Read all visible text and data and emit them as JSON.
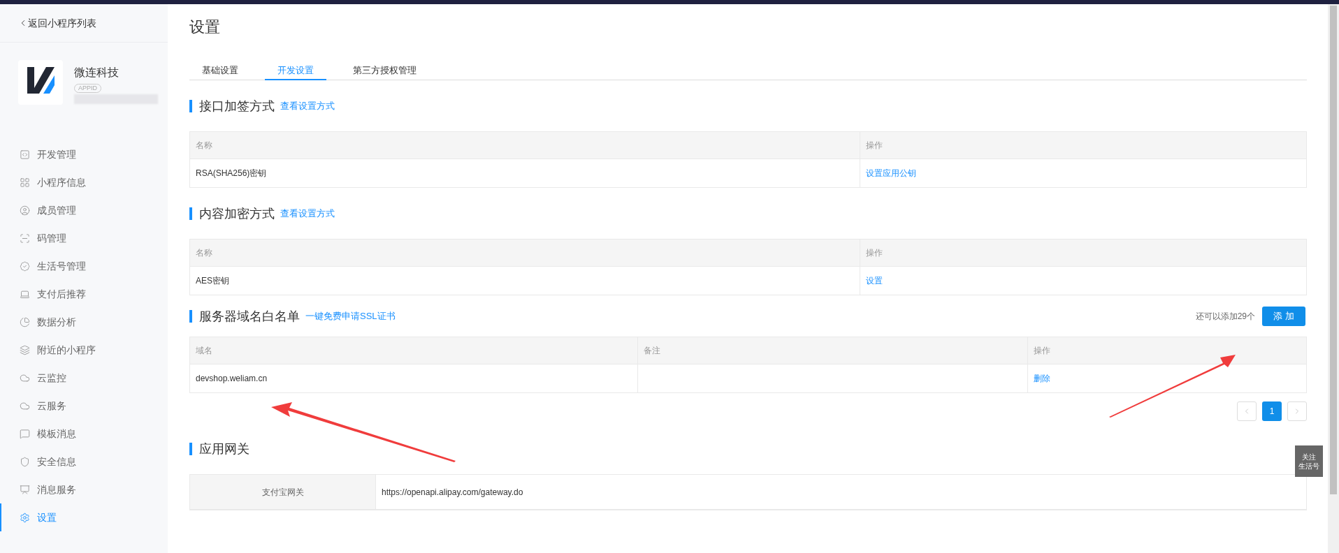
{
  "sidebar": {
    "back_link": "返回小程序列表",
    "app": {
      "name": "微连科技",
      "badge": "APPID"
    },
    "items": [
      {
        "label": "开发管理",
        "selected": false
      },
      {
        "label": "小程序信息",
        "selected": false
      },
      {
        "label": "成员管理",
        "selected": false
      },
      {
        "label": "码管理",
        "selected": false
      },
      {
        "label": "生活号管理",
        "selected": false
      },
      {
        "label": "支付后推荐",
        "selected": false
      },
      {
        "label": "数据分析",
        "selected": false
      },
      {
        "label": "附近的小程序",
        "selected": false
      },
      {
        "label": "云监控",
        "selected": false
      },
      {
        "label": "云服务",
        "selected": false
      },
      {
        "label": "模板消息",
        "selected": false
      },
      {
        "label": "安全信息",
        "selected": false
      },
      {
        "label": "消息服务",
        "selected": false
      },
      {
        "label": "设置",
        "selected": true
      }
    ]
  },
  "page": {
    "title": "设置",
    "tabs": [
      {
        "label": "基础设置",
        "selected": false
      },
      {
        "label": "开发设置",
        "selected": true
      },
      {
        "label": "第三方授权管理",
        "selected": false
      }
    ],
    "sections": [
      {
        "kind": "table",
        "title": "接口加签方式",
        "link": "查看设置方式",
        "table": {
          "columns": [
            "名称",
            "操作"
          ],
          "rows": [
            [
              {
                "kind": "text",
                "text": "RSA(SHA256)密钥"
              },
              {
                "kind": "link",
                "text": "设置应用公钥"
              }
            ]
          ]
        }
      },
      {
        "kind": "table",
        "title": "内容加密方式",
        "link": "查看设置方式",
        "table": {
          "columns": [
            "名称",
            "操作"
          ],
          "rows": [
            [
              {
                "kind": "text",
                "text": "AES密钥"
              },
              {
                "kind": "link",
                "text": "设置"
              }
            ]
          ]
        }
      },
      {
        "kind": "whitelist",
        "title": "服务器域名白名单",
        "link": "一键免费申请SSL证书",
        "remaining": "还可以添加29个",
        "add_button": "添 加",
        "table": {
          "columns": [
            "域名",
            "备注",
            "操作"
          ],
          "rows": [
            [
              {
                "kind": "text",
                "text": "devshop.weliam.cn"
              },
              {
                "kind": "empty"
              },
              {
                "kind": "link",
                "text": "删除"
              }
            ]
          ]
        },
        "pages": [
          {
            "label": "1",
            "selected": true
          }
        ]
      },
      {
        "kind": "keyvalue",
        "title": "应用网关",
        "rows": [
          {
            "key": "支付宝网关",
            "value": "https://openapi.alipay.com/gateway.do"
          }
        ]
      }
    ]
  },
  "float_button": [
    "关注",
    "生活号"
  ]
}
